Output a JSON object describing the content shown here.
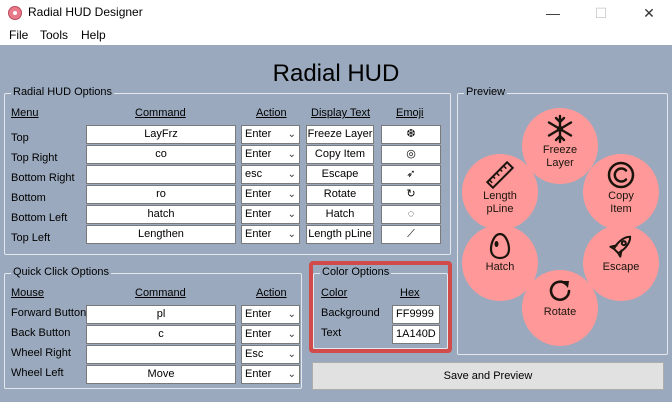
{
  "window": {
    "title": "Radial HUD Designer"
  },
  "menu": [
    "File",
    "Tools",
    "Help"
  ],
  "heading": "Radial HUD",
  "options": {
    "group_title": "Radial HUD Options",
    "headers": {
      "menu": "Menu",
      "command": "Command",
      "action": "Action",
      "display": "Display Text",
      "emoji": "Emoji"
    },
    "rows": [
      {
        "menu": "Top",
        "command": "LayFrz",
        "action": "Enter",
        "display": "Freeze Layer",
        "emoji": "❆"
      },
      {
        "menu": "Top Right",
        "command": "co",
        "action": "Enter",
        "display": "Copy Item",
        "emoji": "◎"
      },
      {
        "menu": "Bottom Right",
        "command": "",
        "action": "esc",
        "display": "Escape",
        "emoji": "➶"
      },
      {
        "menu": "Bottom",
        "command": "ro",
        "action": "Enter",
        "display": "Rotate",
        "emoji": "↻"
      },
      {
        "menu": "Bottom Left",
        "command": "hatch",
        "action": "Enter",
        "display": "Hatch",
        "emoji": "◌"
      },
      {
        "menu": "Top Left",
        "command": "Lengthen",
        "action": "Enter",
        "display": "Length pLine",
        "emoji": "⟋"
      }
    ]
  },
  "quick": {
    "group_title": "Quick Click Options",
    "headers": {
      "mouse": "Mouse",
      "command": "Command",
      "action": "Action"
    },
    "rows": [
      {
        "mouse": "Forward Button",
        "command": "pl",
        "action": "Enter"
      },
      {
        "mouse": "Back Button",
        "command": "c",
        "action": "Enter"
      },
      {
        "mouse": "Wheel Right",
        "command": "",
        "action": "Esc"
      },
      {
        "mouse": "Wheel Left",
        "command": "Move",
        "action": "Enter"
      }
    ]
  },
  "colors": {
    "group_title": "Color Options",
    "headers": {
      "color": "Color",
      "hex": "Hex"
    },
    "background_label": "Background",
    "background_hex": "FF9999",
    "text_label": "Text",
    "text_hex": "1A140D",
    "accent": "#d24b4b"
  },
  "preview": {
    "group_title": "Preview",
    "items": {
      "top": {
        "line1": "Freeze",
        "line2": "Layer",
        "icon": "snowflake-icon"
      },
      "top_right": {
        "line1": "Copy",
        "line2": "Item",
        "icon": "copyright-icon"
      },
      "bottom_right": {
        "line1": "Escape",
        "line2": "",
        "icon": "rocket-icon"
      },
      "bottom": {
        "line1": "Rotate",
        "line2": "",
        "icon": "rotate-icon"
      },
      "bottom_left": {
        "line1": "Hatch",
        "line2": "",
        "icon": "egg-icon"
      },
      "top_left": {
        "line1": "Length",
        "line2": "pLine",
        "icon": "ruler-icon"
      }
    }
  },
  "save_button": "Save and Preview"
}
